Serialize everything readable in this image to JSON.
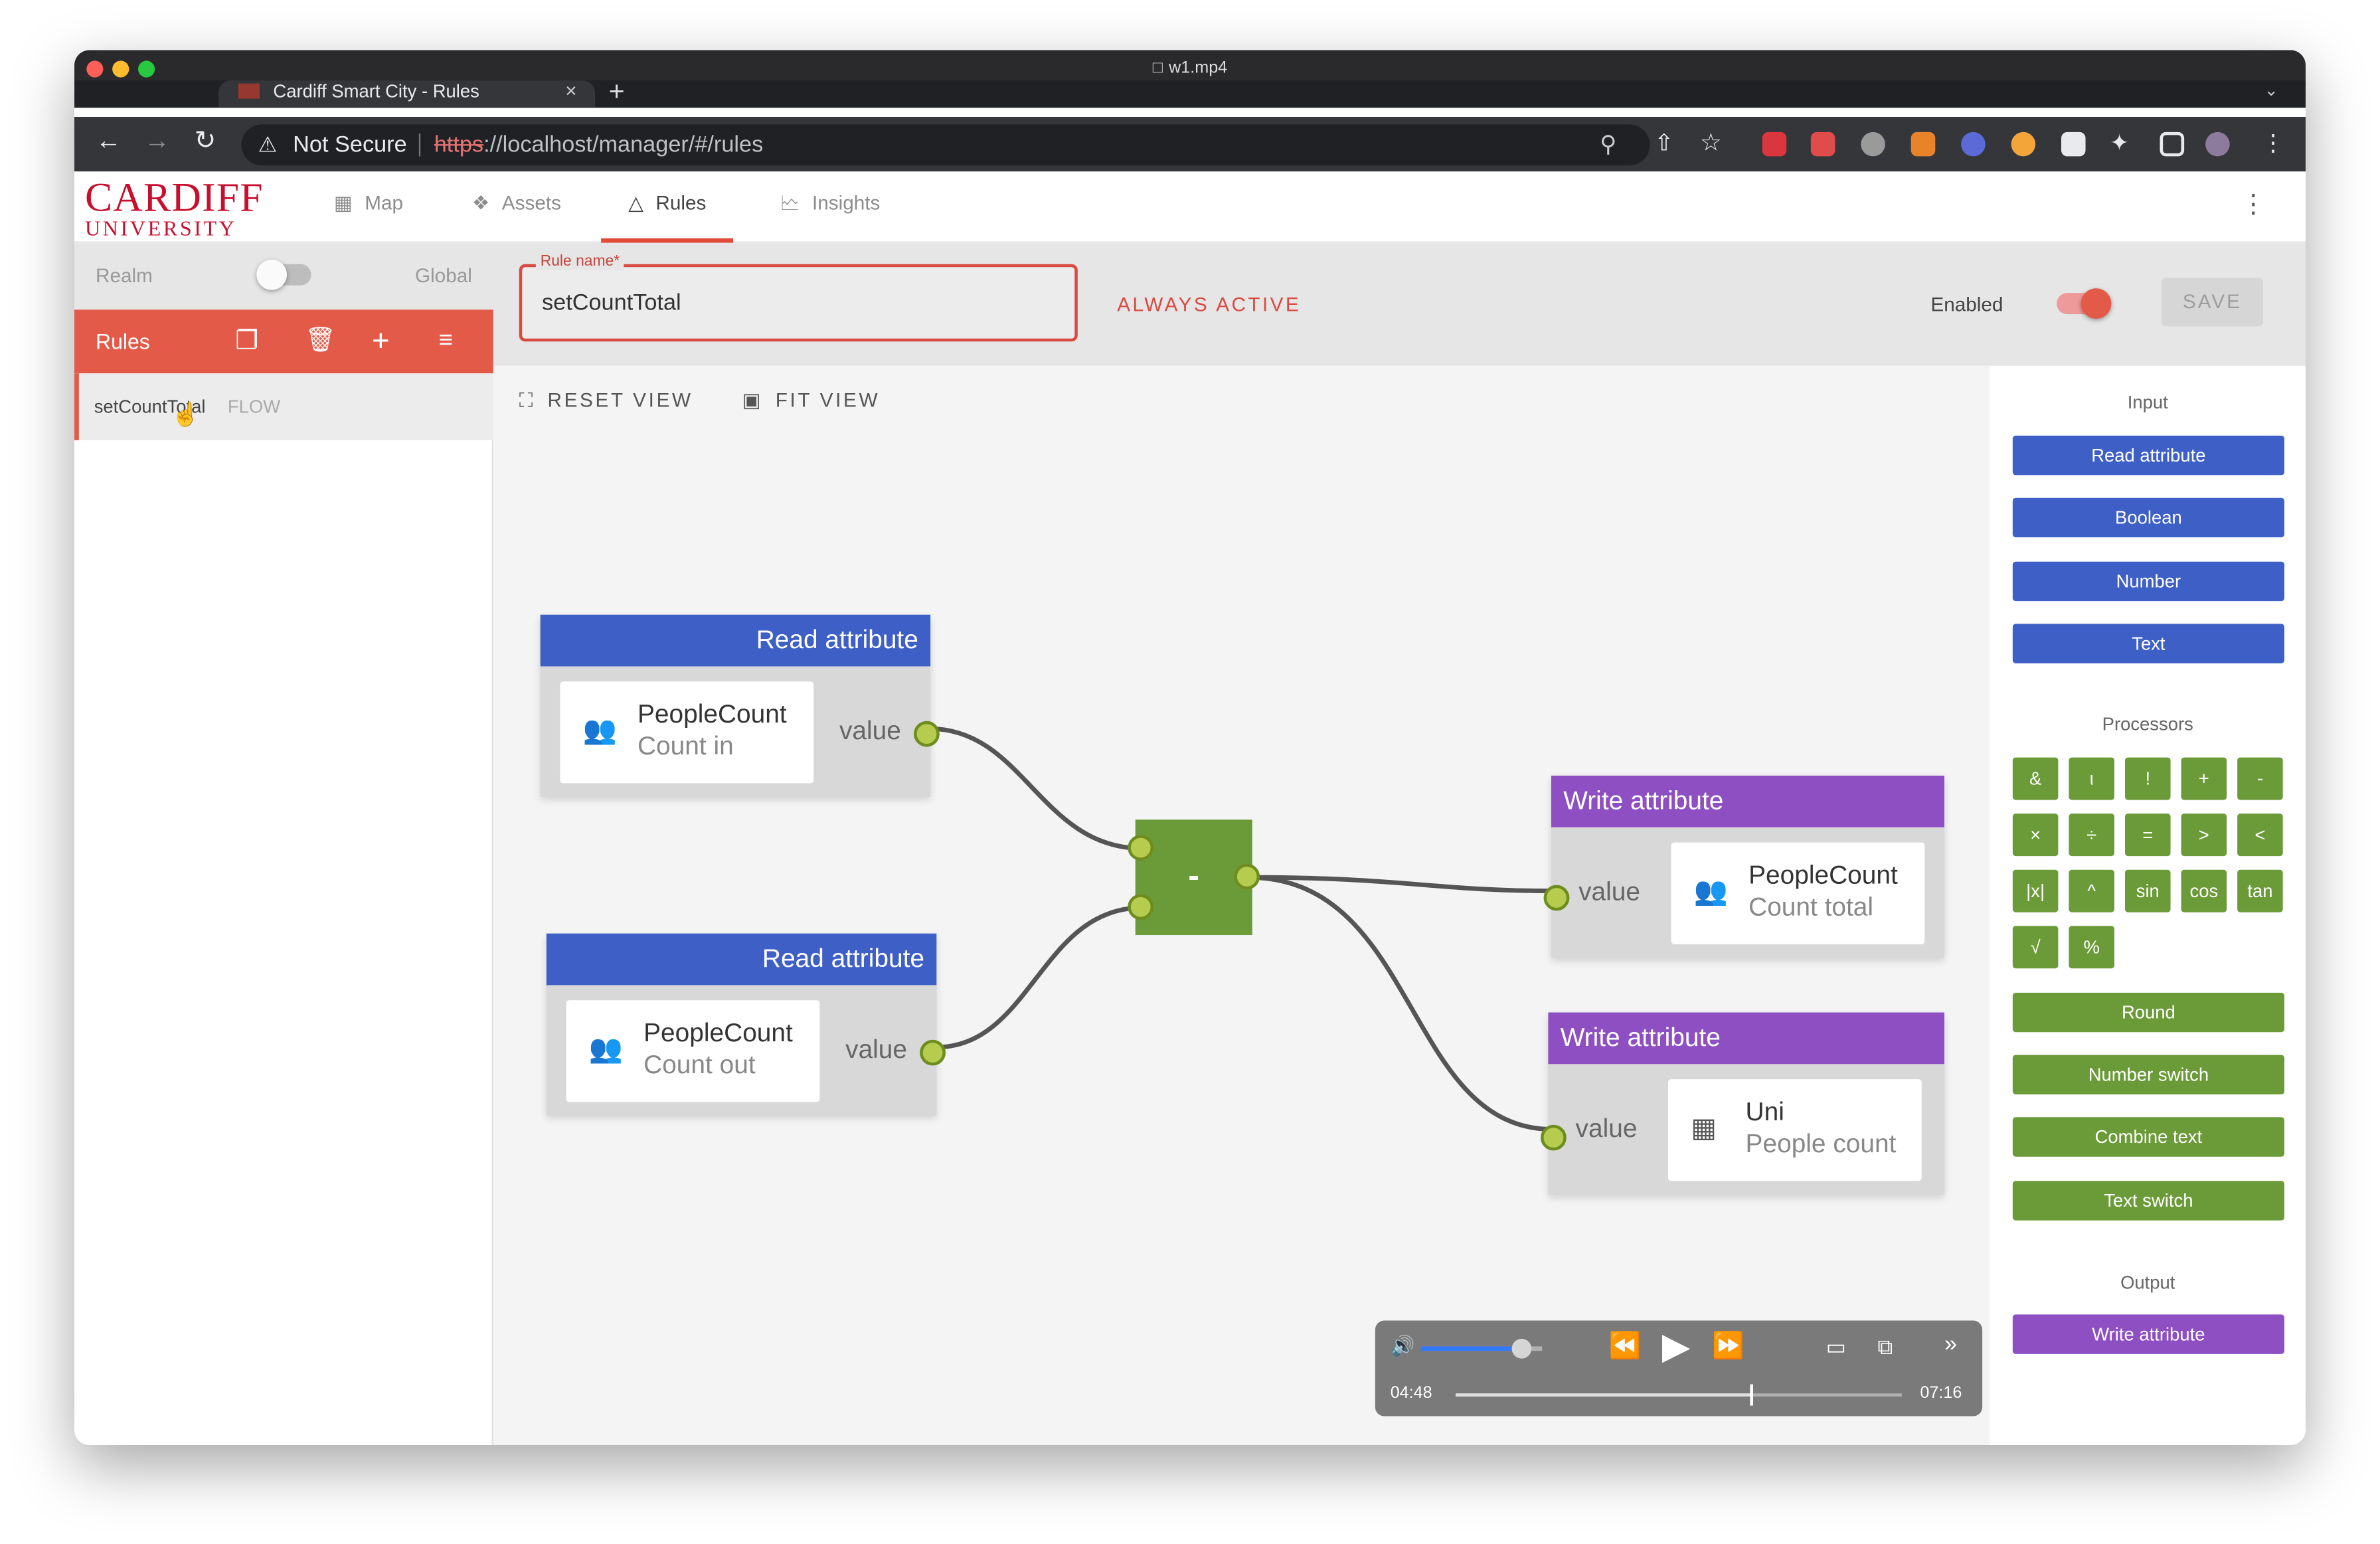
{
  "window": {
    "title": "w1.mp4"
  },
  "browser": {
    "tab_title": "Cardiff Smart City - Rules",
    "security": "Not Secure",
    "url_scheme": "https",
    "url_rest": "://localhost/manager/#/rules"
  },
  "logo": {
    "line1": "CARDIFF",
    "line2": "UNIVERSITY"
  },
  "nav": {
    "tabs": [
      {
        "label": "Map",
        "icon": "map-icon"
      },
      {
        "label": "Assets",
        "icon": "assets-icon"
      },
      {
        "label": "Rules",
        "icon": "rules-icon",
        "active": true
      },
      {
        "label": "Insights",
        "icon": "insights-icon"
      }
    ]
  },
  "sidebar": {
    "realm_label": "Realm",
    "global_label": "Global",
    "rules_header": "Rules",
    "rule_items": [
      {
        "name": "setCountTotal",
        "type": "FLOW"
      }
    ]
  },
  "rule": {
    "name_label": "Rule name*",
    "name_value": "setCountTotal",
    "always_active": "ALWAYS ACTIVE",
    "enabled_label": "Enabled",
    "enabled": true,
    "save_label": "SAVE"
  },
  "canvas": {
    "reset_view": "RESET VIEW",
    "fit_view": "FIT VIEW"
  },
  "nodes": {
    "read_in": {
      "header": "Read attribute",
      "asset": "PeopleCount",
      "attribute": "Count in",
      "port_label": "value"
    },
    "read_out": {
      "header": "Read attribute",
      "asset": "PeopleCount",
      "attribute": "Count out",
      "port_label": "value"
    },
    "op": {
      "symbol": "-"
    },
    "write_total": {
      "header": "Write attribute",
      "asset": "PeopleCount",
      "attribute": "Count total",
      "port_label": "value"
    },
    "write_uni": {
      "header": "Write attribute",
      "asset": "Uni",
      "attribute": "People count",
      "port_label": "value"
    }
  },
  "palette": {
    "input_title": "Input",
    "inputs": [
      "Read attribute",
      "Boolean",
      "Number",
      "Text"
    ],
    "processors_title": "Processors",
    "ops": [
      "&",
      "ι",
      "!",
      "+",
      "-",
      "×",
      "÷",
      "=",
      ">",
      "<",
      "|x|",
      "^",
      "sin",
      "cos",
      "tan",
      "√",
      "%"
    ],
    "processor_buttons": [
      "Round",
      "Number switch",
      "Combine text",
      "Text switch"
    ],
    "output_title": "Output",
    "outputs": [
      "Write attribute"
    ]
  },
  "player": {
    "elapsed": "04:48",
    "duration": "07:16",
    "progress": 0.66,
    "volume": 0.82
  }
}
